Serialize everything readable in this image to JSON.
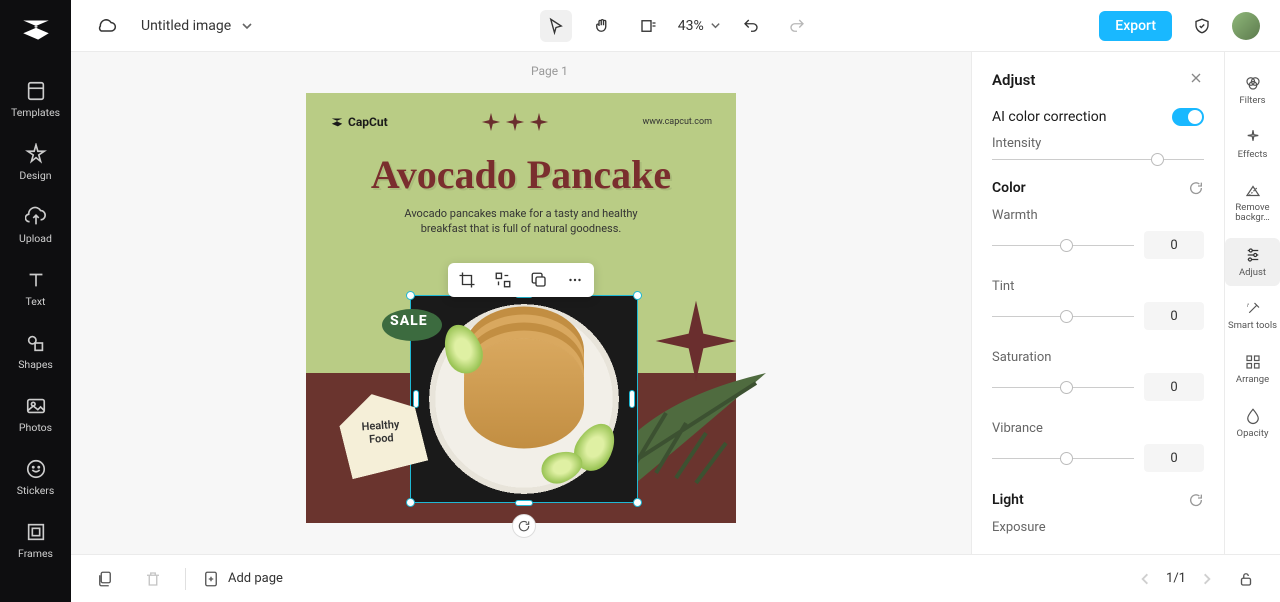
{
  "app": {
    "title": "Untitled image"
  },
  "nav": {
    "items": [
      {
        "label": "Templates"
      },
      {
        "label": "Design"
      },
      {
        "label": "Upload"
      },
      {
        "label": "Text"
      },
      {
        "label": "Shapes"
      },
      {
        "label": "Photos"
      },
      {
        "label": "Stickers"
      },
      {
        "label": "Frames"
      }
    ]
  },
  "topbar": {
    "zoom": "43%",
    "export": "Export"
  },
  "canvas": {
    "page_label": "Page 1",
    "brand": "CapCut",
    "url": "www.capcut.com",
    "headline": "Avocado Pancake",
    "sub1": "Avocado pancakes make for a tasty and healthy",
    "sub2": "breakfast that is full of natural goodness.",
    "sale": "SALE",
    "tag_l1": "Healthy",
    "tag_l2": "Food"
  },
  "adjust": {
    "title": "Adjust",
    "ai_label": "AI color correction",
    "intensity": {
      "label": "Intensity",
      "knob_pct": 75
    },
    "color_section": "Color",
    "warmth": {
      "label": "Warmth",
      "value": "0",
      "knob_pct": 50
    },
    "tint": {
      "label": "Tint",
      "value": "0",
      "knob_pct": 50
    },
    "saturation": {
      "label": "Saturation",
      "value": "0",
      "knob_pct": 50
    },
    "vibrance": {
      "label": "Vibrance",
      "value": "0",
      "knob_pct": 50
    },
    "light_section": "Light",
    "exposure_label": "Exposure"
  },
  "rail": {
    "items": [
      {
        "label": "Filters"
      },
      {
        "label": "Effects"
      },
      {
        "label": "Remove backgr…"
      },
      {
        "label": "Adjust"
      },
      {
        "label": "Smart tools"
      },
      {
        "label": "Arrange"
      },
      {
        "label": "Opacity"
      }
    ]
  },
  "bottombar": {
    "add_page": "Add page",
    "page": "1/1"
  }
}
